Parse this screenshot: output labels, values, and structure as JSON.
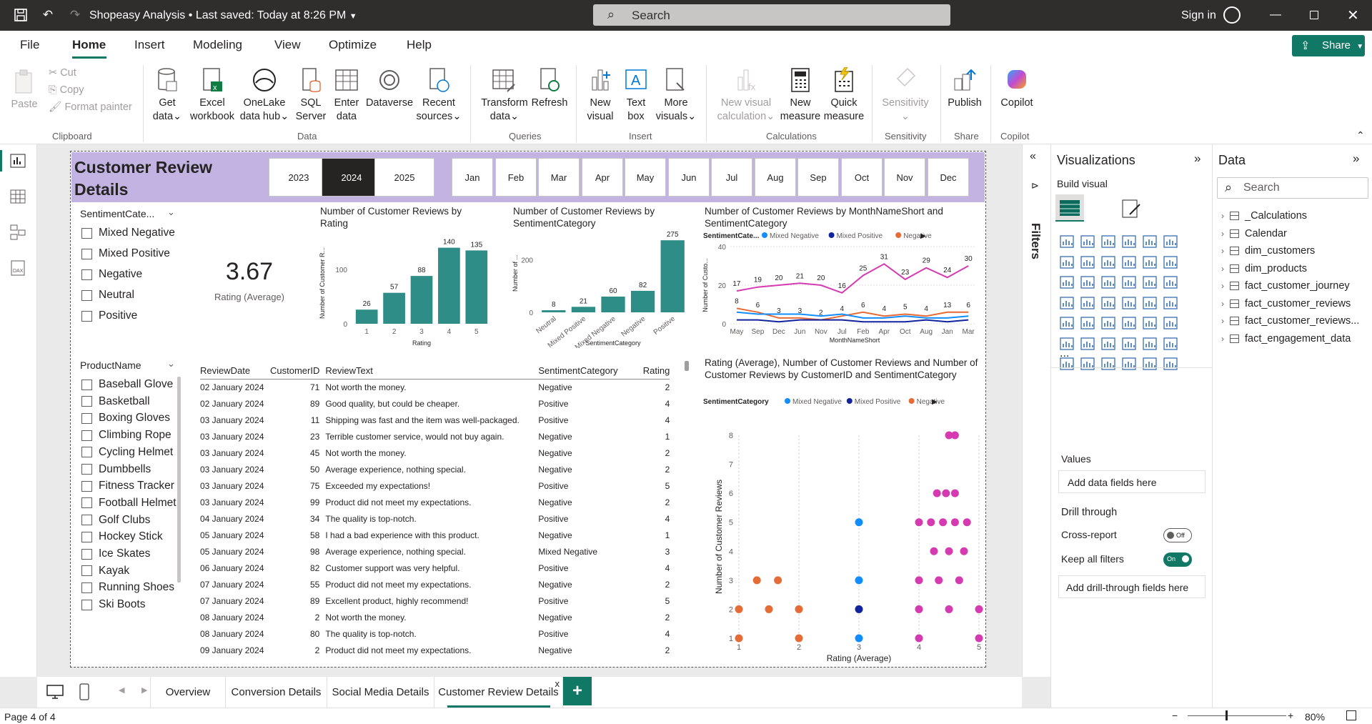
{
  "titlebar": {
    "doc_title": "Shopeasy Analysis",
    "saved_status": "Last saved: Today at 8:26 PM",
    "search_placeholder": "Search",
    "sign_in": "Sign in"
  },
  "menu": {
    "items": [
      "File",
      "Home",
      "Insert",
      "Modeling",
      "View",
      "Optimize",
      "Help"
    ],
    "active": "Home",
    "share": "Share"
  },
  "ribbon": {
    "clipboard": {
      "paste": "Paste",
      "cut": "Cut",
      "copy": "Copy",
      "format_painter": "Format painter",
      "group": "Clipboard"
    },
    "data": {
      "get_data": [
        "Get",
        "data"
      ],
      "excel": [
        "Excel",
        "workbook"
      ],
      "onelake": [
        "OneLake",
        "data hub"
      ],
      "sql": [
        "SQL",
        "Server"
      ],
      "enter": [
        "Enter",
        "data"
      ],
      "dataverse": "Dataverse",
      "recent": [
        "Recent",
        "sources"
      ],
      "group": "Data"
    },
    "queries": {
      "transform": [
        "Transform",
        "data"
      ],
      "refresh": "Refresh",
      "group": "Queries"
    },
    "insert": {
      "new_visual": [
        "New",
        "visual"
      ],
      "text_box": [
        "Text",
        "box"
      ],
      "more_visuals": [
        "More",
        "visuals"
      ],
      "group": "Insert"
    },
    "calculations": {
      "new_visual_calc": [
        "New visual",
        "calculation"
      ],
      "new_measure": [
        "New",
        "measure"
      ],
      "quick_measure": [
        "Quick",
        "measure"
      ],
      "group": "Calculations"
    },
    "sensitivity": {
      "label": "Sensitivity",
      "group": "Sensitivity"
    },
    "share": {
      "publish": "Publish",
      "group": "Share"
    },
    "copilot": {
      "label": "Copilot",
      "group": "Copilot"
    }
  },
  "report": {
    "title": "Customer Review Details",
    "years": [
      "2023",
      "2024",
      "2025"
    ],
    "selected_year": "2024",
    "months": [
      "Jan",
      "Feb",
      "Mar",
      "Apr",
      "May",
      "Jun",
      "Jul",
      "Aug",
      "Sep",
      "Oct",
      "Nov",
      "Dec"
    ],
    "sentiment_slicer": {
      "header": "SentimentCate...",
      "items": [
        "Mixed Negative",
        "Mixed Positive",
        "Negative",
        "Neutral",
        "Positive"
      ]
    },
    "kpi": {
      "value": "3.67",
      "label": "Rating (Average)"
    },
    "product_slicer": {
      "header": "ProductName",
      "items": [
        "Baseball Glove",
        "Basketball",
        "Boxing Gloves",
        "Climbing Rope",
        "Cycling Helmet",
        "Dumbbells",
        "Fitness Tracker",
        "Football Helmet",
        "Golf Clubs",
        "Hockey Stick",
        "Ice Skates",
        "Kayak",
        "Running Shoes",
        "Ski Boots"
      ]
    },
    "table": {
      "headers": [
        "ReviewDate",
        "CustomerID",
        "ReviewText",
        "SentimentCategory",
        "Rating"
      ],
      "rows": [
        [
          "02 January 2024",
          "71",
          "Not worth the money.",
          "Negative",
          "2"
        ],
        [
          "02 January 2024",
          "89",
          "Good quality, but could be cheaper.",
          "Positive",
          "4"
        ],
        [
          "03 January 2024",
          "11",
          "Shipping was fast and the item was well-packaged.",
          "Positive",
          "4"
        ],
        [
          "03 January 2024",
          "23",
          "Terrible customer service, would not buy again.",
          "Negative",
          "1"
        ],
        [
          "03 January 2024",
          "45",
          "Not worth the money.",
          "Negative",
          "2"
        ],
        [
          "03 January 2024",
          "50",
          "Average experience, nothing special.",
          "Negative",
          "2"
        ],
        [
          "03 January 2024",
          "75",
          "Exceeded my expectations!",
          "Positive",
          "5"
        ],
        [
          "03 January 2024",
          "99",
          "Product did not meet my expectations.",
          "Negative",
          "2"
        ],
        [
          "04 January 2024",
          "34",
          "The quality is top-notch.",
          "Positive",
          "4"
        ],
        [
          "05 January 2024",
          "58",
          "I had a bad experience with this product.",
          "Negative",
          "1"
        ],
        [
          "05 January 2024",
          "98",
          "Average experience, nothing special.",
          "Mixed Negative",
          "3"
        ],
        [
          "06 January 2024",
          "82",
          "Customer support was very helpful.",
          "Positive",
          "4"
        ],
        [
          "07 January 2024",
          "55",
          "Product did not meet my expectations.",
          "Negative",
          "2"
        ],
        [
          "07 January 2024",
          "89",
          "Excellent product, highly recommend!",
          "Positive",
          "5"
        ],
        [
          "08 January 2024",
          "2",
          "Not worth the money.",
          "Negative",
          "2"
        ],
        [
          "08 January 2024",
          "80",
          "The quality is top-notch.",
          "Positive",
          "4"
        ],
        [
          "09 January 2024",
          "2",
          "Product did not meet my expectations.",
          "Negative",
          "2"
        ]
      ]
    }
  },
  "chart_data": [
    {
      "type": "bar",
      "title": "Number of Customer Reviews by Rating",
      "xlabel": "Rating",
      "ylabel": "Number of Customer R...",
      "categories": [
        "1",
        "2",
        "3",
        "4",
        "5"
      ],
      "values": [
        26,
        57,
        88,
        140,
        135
      ],
      "yticks": [
        "0",
        "100"
      ],
      "ylim": [
        0,
        150
      ],
      "color": "#2f8d88"
    },
    {
      "type": "bar",
      "title": "Number of Customer Reviews by SentimentCategory",
      "xlabel": "SentimentCategory",
      "ylabel": "Number of ...",
      "categories": [
        "Neutral",
        "Mixed Positive",
        "Mixed Negative",
        "Negative",
        "Positive"
      ],
      "values": [
        8,
        21,
        60,
        82,
        275
      ],
      "yticks": [
        "0",
        "200"
      ],
      "ylim": [
        0,
        300
      ],
      "color": "#2f8d88"
    },
    {
      "type": "line",
      "title": "Number of Customer Reviews by MonthNameShort and SentimentCategory",
      "xlabel": "MonthNameShort",
      "ylabel": "Number of Custo...",
      "legend_title": "SentimentCate...",
      "legend": [
        "Mixed Negative",
        "Mixed Positive",
        "Negative"
      ],
      "x": [
        "May",
        "Sep",
        "Dec",
        "Jun",
        "Nov",
        "Jul",
        "Feb",
        "Apr",
        "Oct",
        "Aug",
        "Jan",
        "Mar"
      ],
      "yticks": [
        "0",
        "20",
        "40"
      ],
      "ylim": [
        0,
        40
      ],
      "series": [
        {
          "name": "Positive",
          "color": "#d63ab1",
          "values": [
            17,
            19,
            20,
            21,
            20,
            16,
            25,
            31,
            23,
            29,
            24,
            30
          ]
        },
        {
          "name": "Negative",
          "color": "#e66c37",
          "values": [
            8,
            6,
            3,
            3,
            2,
            4,
            6,
            4,
            5,
            4,
            6,
            6
          ]
        },
        {
          "name": "Mixed Negative",
          "color": "#118dff",
          "values": [
            6,
            5,
            5,
            5,
            4,
            5,
            3,
            3,
            4,
            3,
            3,
            4
          ]
        },
        {
          "name": "Mixed Positive",
          "color": "#12239e",
          "values": [
            2,
            2,
            1,
            2,
            2,
            2,
            1,
            1,
            1,
            2,
            1,
            2
          ]
        }
      ],
      "labels": [
        [
          "17",
          "19",
          "20",
          "21",
          "20",
          "16",
          "25",
          "31",
          "23",
          "29",
          "24",
          "30"
        ],
        [
          "8",
          "6",
          "3",
          "3",
          "2",
          "4",
          "6",
          "4",
          "5",
          "4",
          "13",
          "6"
        ]
      ]
    },
    {
      "type": "scatter",
      "title": "Rating (Average), Number of Customer Reviews and Number of Customer Reviews by CustomerID and SentimentCategory",
      "xlabel": "Rating (Average)",
      "ylabel": "Number of Customer Reviews",
      "legend_title": "SentimentCategory",
      "legend": [
        "Mixed Negative",
        "Mixed Positive",
        "Negative"
      ],
      "xlim": [
        1,
        5
      ],
      "ylim": [
        1,
        8
      ],
      "xticks": [
        "1",
        "2",
        "3",
        "4",
        "5"
      ],
      "yticks": [
        "1",
        "2",
        "3",
        "4",
        "5",
        "6",
        "7",
        "8"
      ],
      "points": [
        {
          "x": 3,
          "y": 5,
          "c": "#118dff"
        },
        {
          "x": 3,
          "y": 3,
          "c": "#118dff"
        },
        {
          "x": 3,
          "y": 2,
          "c": "#12239e"
        },
        {
          "x": 3,
          "y": 1,
          "c": "#118dff"
        },
        {
          "x": 1.3,
          "y": 3,
          "c": "#e66c37"
        },
        {
          "x": 1.65,
          "y": 3,
          "c": "#e66c37"
        },
        {
          "x": 1,
          "y": 2,
          "c": "#e66c37"
        },
        {
          "x": 1.5,
          "y": 2,
          "c": "#e66c37"
        },
        {
          "x": 2,
          "y": 2,
          "c": "#e66c37"
        },
        {
          "x": 1,
          "y": 1,
          "c": "#e66c37"
        },
        {
          "x": 2,
          "y": 1,
          "c": "#e66c37"
        },
        {
          "x": 4.5,
          "y": 8,
          "c": "#d63ab1"
        },
        {
          "x": 4.6,
          "y": 8,
          "c": "#d63ab1"
        },
        {
          "x": 4.3,
          "y": 6,
          "c": "#d63ab1"
        },
        {
          "x": 4.45,
          "y": 6,
          "c": "#d63ab1"
        },
        {
          "x": 4.6,
          "y": 6,
          "c": "#d63ab1"
        },
        {
          "x": 4,
          "y": 5,
          "c": "#d63ab1"
        },
        {
          "x": 4.2,
          "y": 5,
          "c": "#d63ab1"
        },
        {
          "x": 4.4,
          "y": 5,
          "c": "#d63ab1"
        },
        {
          "x": 4.6,
          "y": 5,
          "c": "#d63ab1"
        },
        {
          "x": 4.8,
          "y": 5,
          "c": "#d63ab1"
        },
        {
          "x": 4.25,
          "y": 4,
          "c": "#d63ab1"
        },
        {
          "x": 4.5,
          "y": 4,
          "c": "#d63ab1"
        },
        {
          "x": 4.75,
          "y": 4,
          "c": "#d63ab1"
        },
        {
          "x": 4,
          "y": 3,
          "c": "#d63ab1"
        },
        {
          "x": 4.33,
          "y": 3,
          "c": "#d63ab1"
        },
        {
          "x": 4.67,
          "y": 3,
          "c": "#d63ab1"
        },
        {
          "x": 4,
          "y": 2,
          "c": "#d63ab1"
        },
        {
          "x": 4.5,
          "y": 2,
          "c": "#d63ab1"
        },
        {
          "x": 5,
          "y": 2,
          "c": "#d63ab1"
        },
        {
          "x": 4,
          "y": 1,
          "c": "#d63ab1"
        },
        {
          "x": 5,
          "y": 1,
          "c": "#d63ab1"
        }
      ]
    }
  ],
  "filters_label": "Filters",
  "visualizations": {
    "title": "Visualizations",
    "build_visual": "Build visual",
    "values": "Values",
    "add_data_fields": "Add data fields here",
    "drill_through": "Drill through",
    "cross_report": "Cross-report",
    "cross_report_state": "Off",
    "keep_all_filters": "Keep all filters",
    "keep_all_state": "On",
    "add_drill_fields": "Add drill-through fields here",
    "more": "..."
  },
  "data_pane": {
    "title": "Data",
    "search_placeholder": "Search",
    "items": [
      "_Calculations",
      "Calendar",
      "dim_customers",
      "dim_products",
      "fact_customer_journey",
      "fact_customer_reviews",
      "fact_customer_reviews...",
      "fact_engagement_data"
    ]
  },
  "tabs": {
    "items": [
      "Overview",
      "Conversion Details",
      "Social Media Details",
      "Customer Review Details"
    ],
    "active": "Customer Review Details",
    "add": "+",
    "close": "x"
  },
  "status": {
    "page": "Page 4 of 4",
    "zoom": "80%"
  },
  "colors": {
    "accent": "#117865",
    "header": "#c3b3e2",
    "teal": "#2f8d88",
    "positive": "#d63ab1",
    "negative": "#e66c37",
    "mixed_negative": "#118dff",
    "mixed_positive": "#12239e"
  }
}
